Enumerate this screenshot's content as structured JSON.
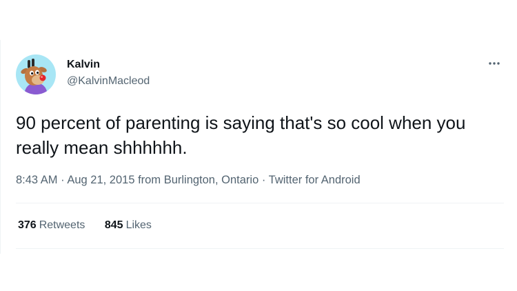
{
  "tweet": {
    "author": {
      "name": "Kalvin",
      "handle": "@KalvinMacleod"
    },
    "text": "90 percent of parenting is saying that's so cool when you really mean shhhhhh.",
    "time": "8:43 AM",
    "date": "Aug 21, 2015",
    "location_prefix": "from",
    "location": "Burlington, Ontario",
    "separator": "·",
    "source": "Twitter for Android",
    "stats": {
      "retweets_count": "376",
      "retweets_label": "Retweets",
      "likes_count": "845",
      "likes_label": "Likes"
    }
  },
  "icons": {
    "more": "more-horizontal-icon",
    "avatar": "reindeer-avatar"
  },
  "colors": {
    "text_primary": "#0f1419",
    "text_secondary": "#536471",
    "divider": "#eff3f4",
    "avatar_bg": "#a8e6f5"
  }
}
